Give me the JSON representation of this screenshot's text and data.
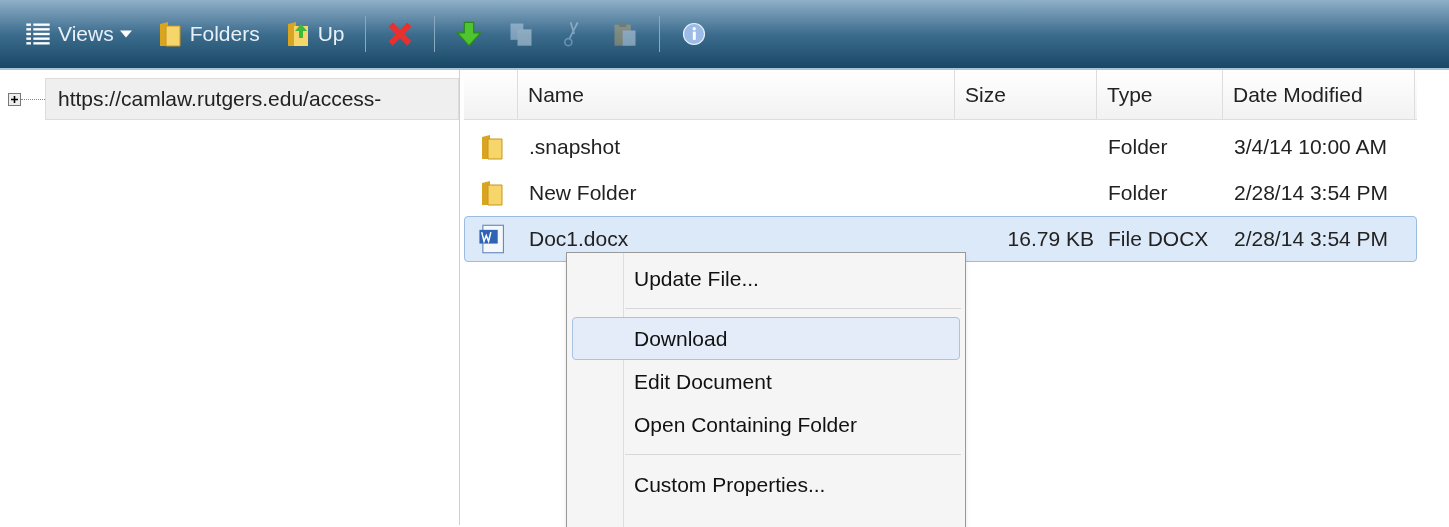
{
  "toolbar": [
    {
      "kind": "button",
      "label": "Views",
      "dropdown": true,
      "disabled": false
    },
    {
      "kind": "button",
      "label": "Folders",
      "dropdown": false,
      "disabled": false
    },
    {
      "kind": "button",
      "label": "Up",
      "dropdown": false,
      "disabled": false
    },
    {
      "kind": "separator"
    },
    {
      "kind": "button",
      "disabled": false
    },
    {
      "kind": "separator"
    },
    {
      "kind": "button",
      "disabled": false
    },
    {
      "kind": "button",
      "disabled": true
    },
    {
      "kind": "button",
      "disabled": true
    },
    {
      "kind": "button",
      "disabled": true
    },
    {
      "kind": "separator"
    },
    {
      "kind": "button",
      "disabled": false
    }
  ],
  "tree": {
    "items": [
      {
        "label": "https://camlaw.rutgers.edu/access-",
        "expanded": false
      }
    ]
  },
  "table": {
    "columns": [
      "Name",
      "Size",
      "Type",
      "Date Modified"
    ],
    "rows": [
      {
        "kind": "folder",
        "name": ".snapshot",
        "size": "",
        "type": "Folder",
        "date": "3/4/14 10:00 AM",
        "selected": false
      },
      {
        "kind": "folder",
        "name": "New Folder",
        "size": "",
        "type": "Folder",
        "date": "2/28/14 3:54 PM",
        "selected": false
      },
      {
        "kind": "word",
        "name": "Doc1.docx",
        "size": "16.79 KB",
        "type": "File DOCX",
        "date": "2/28/14 3:54 PM",
        "selected": true
      }
    ]
  },
  "context_menu": {
    "items": [
      {
        "kind": "item",
        "label": "Update File...",
        "selected": false
      },
      {
        "kind": "separator"
      },
      {
        "kind": "item",
        "label": "Download",
        "selected": true
      },
      {
        "kind": "item",
        "label": "Edit Document",
        "selected": false
      },
      {
        "kind": "item",
        "label": "Open Containing Folder",
        "selected": false
      },
      {
        "kind": "separator"
      },
      {
        "kind": "item",
        "label": "Custom Properties...",
        "selected": false
      }
    ]
  }
}
